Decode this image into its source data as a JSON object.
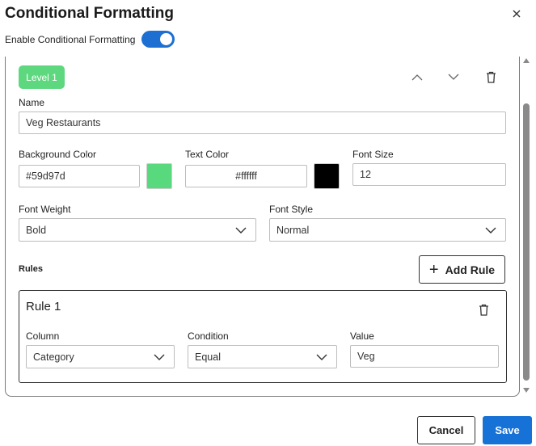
{
  "dialog": {
    "title": "Conditional Formatting",
    "close_icon": "close-icon"
  },
  "toggle": {
    "label": "Enable Conditional Formatting",
    "enabled": true
  },
  "level": {
    "badge": "Level 1",
    "icons": [
      "chevron-up-icon",
      "chevron-down-icon",
      "trash-icon"
    ],
    "name": {
      "label": "Name",
      "value": "Veg Restaurants"
    },
    "background_color": {
      "label": "Background Color",
      "value": "#59d97d",
      "swatch": "#59d97d"
    },
    "text_color": {
      "label": "Text Color",
      "value": "#ffffff",
      "swatch": "#000000"
    },
    "font_size": {
      "label": "Font Size",
      "value": "12"
    },
    "font_weight": {
      "label": "Font Weight",
      "value": "Bold"
    },
    "font_style": {
      "label": "Font Style",
      "value": "Normal"
    }
  },
  "rules": {
    "label": "Rules",
    "add_button": "Add Rule",
    "items": [
      {
        "title": "Rule 1",
        "column": {
          "label": "Column",
          "value": "Category"
        },
        "condition": {
          "label": "Condition",
          "value": "Equal"
        },
        "value": {
          "label": "Value",
          "value": "Veg"
        }
      }
    ]
  },
  "footer": {
    "cancel": "Cancel",
    "save": "Save"
  },
  "colors": {
    "accent": "#1672d6",
    "level_badge": "#5ed87f"
  }
}
